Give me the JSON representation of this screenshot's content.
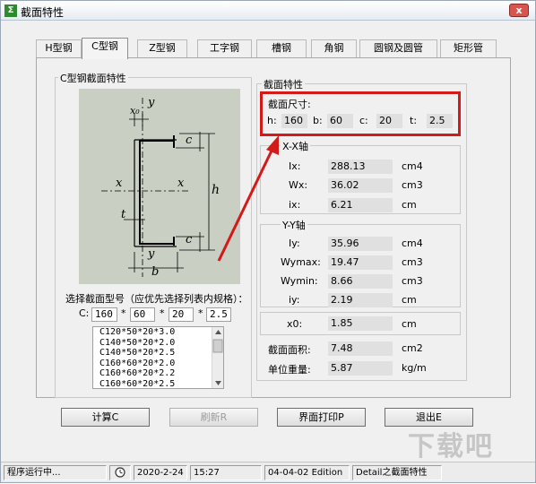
{
  "window": {
    "title": "截面特性",
    "app_icon": "app-icon",
    "close_label": "x"
  },
  "tabs": [
    {
      "label": "H型钢",
      "active": false
    },
    {
      "label": "C型钢",
      "active": true
    },
    {
      "label": "Z型钢",
      "active": false
    },
    {
      "label": "工字钢",
      "active": false
    },
    {
      "label": "槽钢",
      "active": false
    },
    {
      "label": "角钢",
      "active": false
    },
    {
      "label": "圆钢及圆管",
      "active": false
    },
    {
      "label": "矩形管",
      "active": false
    }
  ],
  "left_panel": {
    "group_title": "C型钢截面特性",
    "diagram_labels": {
      "x0": "x₀",
      "y_top": "y",
      "y_bottom": "y",
      "x_left": "x",
      "x_right": "x",
      "c_top": "c",
      "c_bottom": "c",
      "h": "h",
      "t": "t",
      "b": "b"
    },
    "select_prompt": "选择截面型号（应优先选择列表内规格）：",
    "c_label": "C:",
    "star": "*",
    "inputs": {
      "h": "160",
      "b": "60",
      "c": "20",
      "t": "2.5"
    },
    "list_items": [
      "C120*50*20*3.0",
      "C140*50*20*2.0",
      "C140*50*20*2.5",
      "C160*60*20*2.0",
      "C160*60*20*2.2",
      "C160*60*20*2.5"
    ]
  },
  "right_panel": {
    "group_title": "截面特性",
    "section_size": {
      "title": "截面尺寸:",
      "h_label": "h:",
      "h": "160",
      "b_label": "b:",
      "b": "60",
      "c_label": "c:",
      "c": "20",
      "t_label": "t:",
      "t": "2.5",
      "highlight_color": "#d41919"
    },
    "xx_axis": {
      "title": "X-X轴",
      "rows": [
        {
          "label": "Ix:",
          "value": "288.13",
          "unit": "cm4"
        },
        {
          "label": "Wx:",
          "value": "36.02",
          "unit": "cm3"
        },
        {
          "label": "ix:",
          "value": "6.21",
          "unit": "cm"
        }
      ]
    },
    "yy_axis": {
      "title": "Y-Y轴",
      "rows": [
        {
          "label": "Iy:",
          "value": "35.96",
          "unit": "cm4"
        },
        {
          "label": "Wymax:",
          "value": "19.47",
          "unit": "cm3"
        },
        {
          "label": "Wymin:",
          "value": "8.66",
          "unit": "cm3"
        },
        {
          "label": "iy:",
          "value": "2.19",
          "unit": "cm"
        }
      ]
    },
    "x0": {
      "label": "x0:",
      "value": "1.85",
      "unit": "cm"
    },
    "area": {
      "label": "截面面积:",
      "value": "7.48",
      "unit": "cm2"
    },
    "weight": {
      "label": "单位重量:",
      "value": "5.87",
      "unit": "kg/m"
    }
  },
  "buttons": {
    "calculate": "计算C",
    "refresh": "刷新R",
    "print": "界面打印P",
    "exit": "退出E"
  },
  "status_bar": {
    "message": "程序运行中...",
    "date": "2020-2-24",
    "time": "15:27",
    "edition": "04-04-02 Edition",
    "detail": "Detail之截面特性"
  },
  "watermark": "下载吧"
}
